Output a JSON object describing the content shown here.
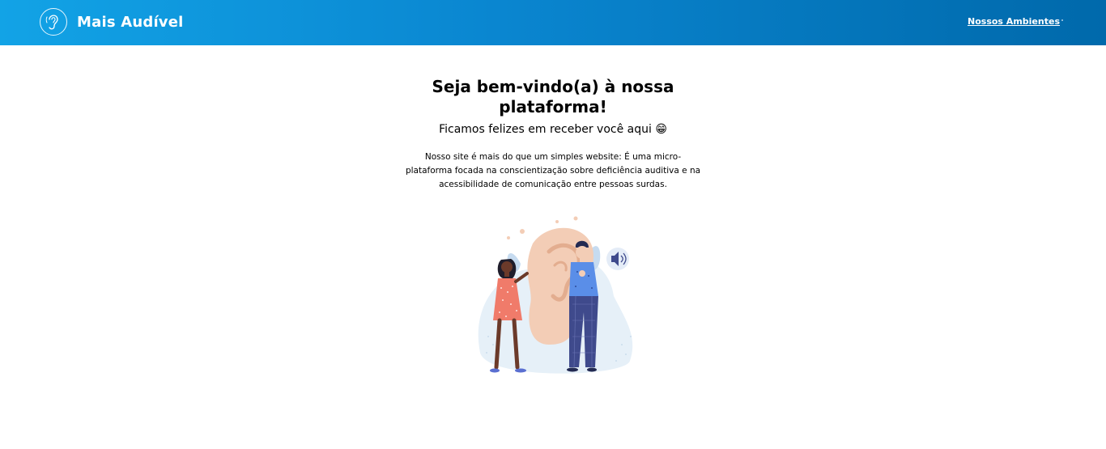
{
  "header": {
    "brand_name": "Mais Audível",
    "nav_link": "Nossos Ambientes"
  },
  "hero": {
    "title": "Seja bem-vindo(a) à nossa plataforma!",
    "subtitle": "Ficamos felizes em receber você aqui 😁",
    "description": "Nosso site é mais do que um simples website: É uma micro-plataforma focada na conscientização sobre deficiência auditiva e na acessibilidade de comunicação entre pessoas surdas."
  },
  "colors": {
    "header_start": "#12a3e6",
    "header_end": "#0069ab"
  },
  "icons": {
    "logo": "ear-icon",
    "sound": "speaker-icon"
  }
}
